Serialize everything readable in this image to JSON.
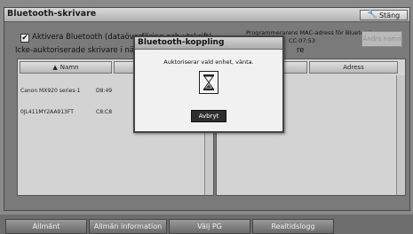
{
  "window": {
    "title": "Bluetooth-skrivare",
    "close_label": "Stäng",
    "close_icon": "wrench-icon"
  },
  "controls": {
    "enable_checkbox_checked": true,
    "enable_label": "Aktivera Bluetooth (dataöverföring och utskrift)",
    "unauthorized_label": "Icke-auktoriserade skrivare i nä",
    "right_list_label": "re",
    "mac_label": "Programmerarens MAC-adress för Bluetooth:",
    "mac_value": "CC:07:53",
    "change_button_label": "Ändra namn"
  },
  "left_list": {
    "columns": [
      "Namn",
      ""
    ],
    "name_sort_icon": "sort-up-icon",
    "rows": [
      {
        "name": "Canon MX920 series-1",
        "address": "D8:49"
      },
      {
        "name": "0JL411MY2AA913FT",
        "address": "C8:C8"
      }
    ]
  },
  "right_list": {
    "columns": [
      "",
      "Adress"
    ]
  },
  "modal": {
    "title": "Bluetooth-koppling",
    "message": "Auktoriserar vald enhet, vänta.",
    "icon": "hourglass-icon",
    "cancel_label": "Avbryt"
  },
  "tabs": [
    {
      "label": "Allmänt"
    },
    {
      "label": "Allmän information"
    },
    {
      "label": "Välj PG"
    },
    {
      "label": "Realtidslogg"
    }
  ]
}
